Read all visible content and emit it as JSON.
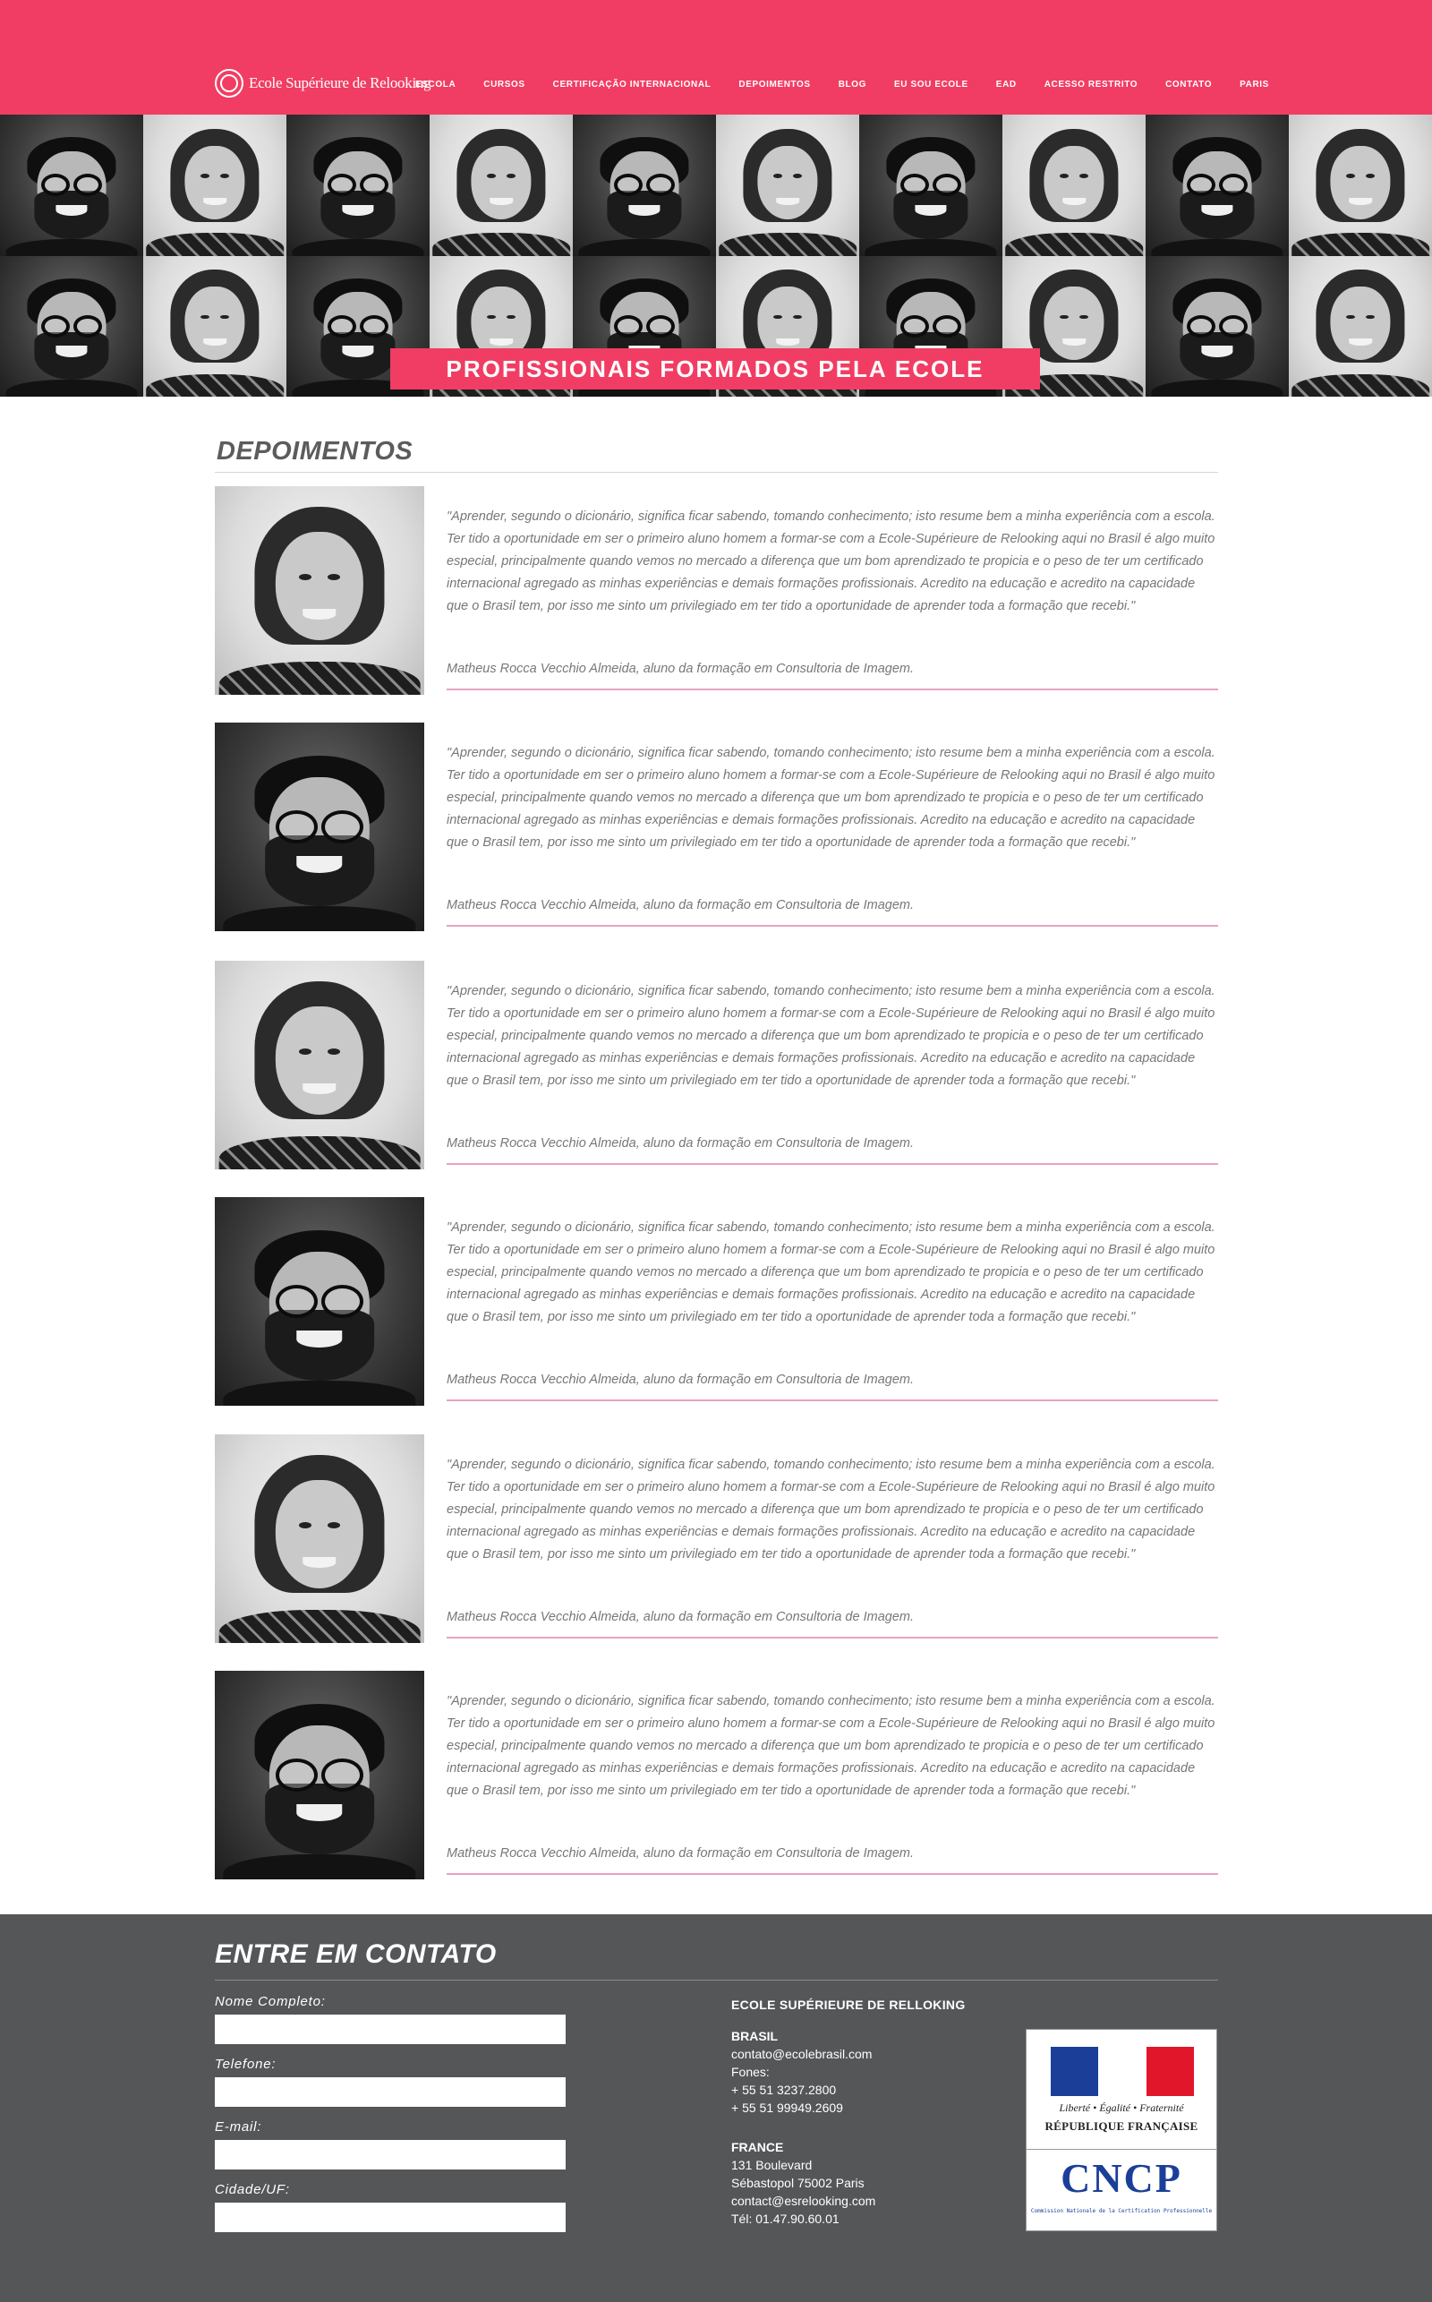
{
  "header": {
    "logo_text": "Ecole Supérieure de Relooking",
    "nav": [
      "ESCOLA",
      "CURSOS",
      "CERTIFICAÇÃO INTERNACIONAL",
      "DEPOIMENTOS",
      "BLOG",
      "EU SOU ECOLE",
      "EAD",
      "ACESSO RESTRITO",
      "CONTATO",
      "PARIS"
    ]
  },
  "hero": {
    "title": "PROFISSIONAIS FORMADOS PELA ECOLE"
  },
  "main": {
    "section_title": "DEPOIMENTOS",
    "testimonials": [
      {
        "photo": "woman",
        "quote": "\"Aprender, segundo o dicionário, significa ficar sabendo, tomando conhecimento; isto resume bem a minha experiência com a escola. Ter tido a oportunidade em ser o primeiro aluno homem a formar-se com a Ecole-Supérieure de Relooking aqui no Brasil é algo muito especial, principalmente quando vemos no mercado a diferença que um bom aprendizado te propicia e o peso de ter um certificado internacional agregado as minhas experiências e demais formações profissionais. Acredito na educação e acredito na capacidade que o Brasil tem, por isso me sinto um privilegiado em ter tido a oportunidade de aprender toda a formação que recebi.\"",
        "author": "Matheus Rocca Vecchio Almeida, aluno da formação em Consultoria de Imagem."
      },
      {
        "photo": "man",
        "quote": "\"Aprender, segundo o dicionário, significa ficar sabendo, tomando conhecimento; isto resume bem a minha experiência com a escola. Ter tido a oportunidade em ser o primeiro aluno homem a formar-se com a Ecole-Supérieure de Relooking aqui no Brasil é algo muito especial, principalmente quando vemos no mercado a diferença que um bom aprendizado te propicia e o peso de ter um certificado internacional agregado as minhas experiências e demais formações profissionais. Acredito na educação e acredito na capacidade que o Brasil tem, por isso me sinto um privilegiado em ter tido a oportunidade de aprender toda a formação que recebi.\"",
        "author": "Matheus Rocca Vecchio Almeida, aluno da formação em Consultoria de Imagem."
      },
      {
        "photo": "woman",
        "quote": "\"Aprender, segundo o dicionário, significa ficar sabendo, tomando conhecimento; isto resume bem a minha experiência com a escola. Ter tido a oportunidade em ser o primeiro aluno homem a formar-se com a Ecole-Supérieure de Relooking aqui no Brasil é algo muito especial, principalmente quando vemos no mercado a diferença que um bom aprendizado te propicia e o peso de ter um certificado internacional agregado as minhas experiências e demais formações profissionais. Acredito na educação e acredito na capacidade que o Brasil tem, por isso me sinto um privilegiado em ter tido a oportunidade de aprender toda a formação que recebi.\"",
        "author": "Matheus Rocca Vecchio Almeida, aluno da formação em Consultoria de Imagem."
      },
      {
        "photo": "man",
        "quote": "\"Aprender, segundo o dicionário, significa ficar sabendo, tomando conhecimento; isto resume bem a minha experiência com a escola. Ter tido a oportunidade em ser o primeiro aluno homem a formar-se com a Ecole-Supérieure de Relooking aqui no Brasil é algo muito especial, principalmente quando vemos no mercado a diferença que um bom aprendizado te propicia e o peso de ter um certificado internacional agregado as minhas experiências e demais formações profissionais. Acredito na educação e acredito na capacidade que o Brasil tem, por isso me sinto um privilegiado em ter tido a oportunidade de aprender toda a formação que recebi.\"",
        "author": "Matheus Rocca Vecchio Almeida, aluno da formação em Consultoria de Imagem."
      },
      {
        "photo": "woman",
        "quote": "\"Aprender, segundo o dicionário, significa ficar sabendo, tomando conhecimento; isto resume bem a minha experiência com a escola. Ter tido a oportunidade em ser o primeiro aluno homem a formar-se com a Ecole-Supérieure de Relooking aqui no Brasil é algo muito especial, principalmente quando vemos no mercado a diferença que um bom aprendizado te propicia e o peso de ter um certificado internacional agregado as minhas experiências e demais formações profissionais. Acredito na educação e acredito na capacidade que o Brasil tem, por isso me sinto um privilegiado em ter tido a oportunidade de aprender toda a formação que recebi.\"",
        "author": "Matheus Rocca Vecchio Almeida, aluno da formação em Consultoria de Imagem."
      },
      {
        "photo": "man",
        "quote": "\"Aprender, segundo o dicionário, significa ficar sabendo, tomando conhecimento; isto resume bem a minha experiência com a escola. Ter tido a oportunidade em ser o primeiro aluno homem a formar-se com a Ecole-Supérieure de Relooking aqui no Brasil é algo muito especial, principalmente quando vemos no mercado a diferença que um bom aprendizado te propicia e o peso de ter um certificado internacional agregado as minhas experiências e demais formações profissionais. Acredito na educação e acredito na capacidade que o Brasil tem, por isso me sinto um privilegiado em ter tido a oportunidade de aprender toda a formação que recebi.\"",
        "author": "Matheus Rocca Vecchio Almeida, aluno da formação em Consultoria de Imagem."
      }
    ]
  },
  "footer": {
    "title": "ENTRE EM CONTATO",
    "form": {
      "name_label": "Nome Completo:",
      "phone_label": "Telefone:",
      "email_label": "E-mail:",
      "city_label": "Cidade/UF:"
    },
    "school_name": "ECOLE SUPÉRIEURE DE RELLOKING",
    "brasil": {
      "heading": "BRASIL",
      "email": "contato@ecolebrasil.com",
      "phones_label": "Fones:",
      "phone1": "+ 55 51 3237.2800",
      "phone2": "+ 55 51 99949.2609"
    },
    "france": {
      "heading": "FRANCE",
      "line1": "131 Boulevard",
      "line2": "Sébastopol 75002 Paris",
      "email": "contact@esrelooking.com",
      "phone": "Tél: 01.47.90.60.01"
    },
    "logos": {
      "rf_motto": "Liberté • Égalité • Fraternité",
      "rf_name": "RÉPUBLIQUE FRANÇAISE",
      "cncp_word": "CNCP",
      "cncp_sub": "Commission Nationale de la Certification Professionnelle"
    }
  },
  "colors": {
    "brand_pink": "#f13d63",
    "footer_gray": "#555658",
    "rule_pink": "#e9a2c2"
  }
}
